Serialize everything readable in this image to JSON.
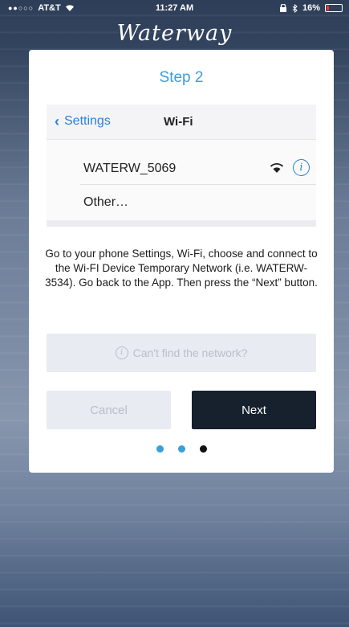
{
  "status_bar": {
    "signal_dots": "●●○○○",
    "carrier": "AT&T",
    "time": "11:27 AM",
    "battery_text": "16%",
    "battery_level": 0.16
  },
  "app": {
    "brand": "Waterway"
  },
  "dialog": {
    "step_title": "Step 2",
    "wifi_screen": {
      "back_label": "Settings",
      "title": "Wi-Fi",
      "networks": [
        {
          "name": "WATERW_5069"
        },
        {
          "name": "Other…"
        }
      ]
    },
    "instructions": "Go to your phone Settings, Wi-Fi, choose and connect to the Wi-FI Device Temporary Network (i.e. WATERW-3534). Go back to the App. Then press the “Next” button.",
    "cant_find_label": "Can't find the network?",
    "cancel_label": "Cancel",
    "next_label": "Next",
    "pager": {
      "total": 3,
      "current": 3
    }
  },
  "colors": {
    "accent": "#3a9fd8",
    "ios_link": "#2b7fd8",
    "next_button": "#17202d",
    "disabled_bg": "#e8ebf1",
    "disabled_text": "#b8bec9"
  }
}
